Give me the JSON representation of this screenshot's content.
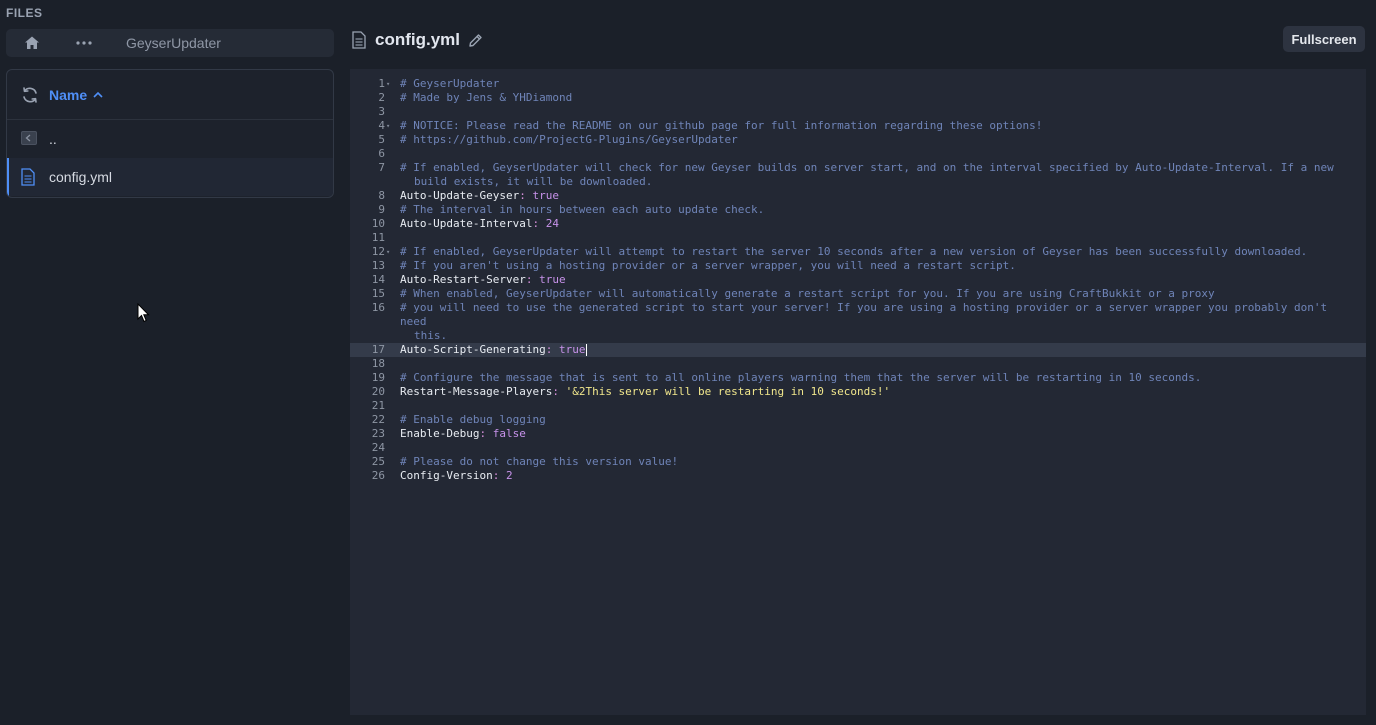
{
  "sidebar": {
    "section_label": "FILES",
    "breadcrumb_current": "GeyserUpdater",
    "sort_label": "Name",
    "files": [
      {
        "name": ".."
      },
      {
        "name": "config.yml"
      }
    ]
  },
  "editor": {
    "filename": "config.yml",
    "fullscreen_label": "Fullscreen",
    "current_line": 17,
    "lines": [
      {
        "num": "1",
        "fold": true,
        "parts": [
          {
            "t": "# GeyserUpdater",
            "c": "comment"
          }
        ]
      },
      {
        "num": "2",
        "parts": [
          {
            "t": "# Made by Jens & YHDiamond",
            "c": "comment"
          }
        ]
      },
      {
        "num": "3",
        "parts": []
      },
      {
        "num": "4",
        "fold": true,
        "parts": [
          {
            "t": "# NOTICE: Please read the README on our github page for full information regarding these options!",
            "c": "comment"
          }
        ]
      },
      {
        "num": "5",
        "parts": [
          {
            "t": "# https://github.com/ProjectG-Plugins/GeyserUpdater",
            "c": "comment"
          }
        ]
      },
      {
        "num": "6",
        "parts": []
      },
      {
        "num": "7",
        "parts": [
          {
            "t": "# If enabled, GeyserUpdater will check for new Geyser builds on server start, and on the interval specified by Auto-Update-Interval. If a new",
            "c": "comment"
          }
        ],
        "cont": "build exists, it will be downloaded."
      },
      {
        "num": "8",
        "parts": [
          {
            "t": "Auto-Update-Geyser",
            "c": "key"
          },
          {
            "t": ": ",
            "c": "punc"
          },
          {
            "t": "true",
            "c": "bool"
          }
        ]
      },
      {
        "num": "9",
        "parts": [
          {
            "t": "# The interval in hours between each auto update check.",
            "c": "comment"
          }
        ]
      },
      {
        "num": "10",
        "parts": [
          {
            "t": "Auto-Update-Interval",
            "c": "key"
          },
          {
            "t": ": ",
            "c": "punc"
          },
          {
            "t": "24",
            "c": "num"
          }
        ]
      },
      {
        "num": "11",
        "parts": []
      },
      {
        "num": "12",
        "fold": true,
        "parts": [
          {
            "t": "# If enabled, GeyserUpdater will attempt to restart the server 10 seconds after a new version of Geyser has been successfully downloaded.",
            "c": "comment"
          }
        ]
      },
      {
        "num": "13",
        "parts": [
          {
            "t": "# If you aren't using a hosting provider or a server wrapper, you will need a restart script.",
            "c": "comment"
          }
        ]
      },
      {
        "num": "14",
        "parts": [
          {
            "t": "Auto-Restart-Server",
            "c": "key"
          },
          {
            "t": ": ",
            "c": "punc"
          },
          {
            "t": "true",
            "c": "bool"
          }
        ]
      },
      {
        "num": "15",
        "parts": [
          {
            "t": "# When enabled, GeyserUpdater will automatically generate a restart script for you. If you are using CraftBukkit or a proxy",
            "c": "comment"
          }
        ]
      },
      {
        "num": "16",
        "parts": [
          {
            "t": "# you will need to use the generated script to start your server! If you are using a hosting provider or a server wrapper you probably don't need",
            "c": "comment"
          }
        ],
        "cont": "this."
      },
      {
        "num": "17",
        "parts": [
          {
            "t": "Auto-Script-Generating",
            "c": "key"
          },
          {
            "t": ": ",
            "c": "punc"
          },
          {
            "t": "true",
            "c": "bool"
          }
        ]
      },
      {
        "num": "18",
        "parts": []
      },
      {
        "num": "19",
        "parts": [
          {
            "t": "# Configure the message that is sent to all online players warning them that the server will be restarting in 10 seconds.",
            "c": "comment"
          }
        ]
      },
      {
        "num": "20",
        "parts": [
          {
            "t": "Restart-Message-Players",
            "c": "key"
          },
          {
            "t": ": ",
            "c": "punc"
          },
          {
            "t": "'&2This server will be restarting in 10 seconds!'",
            "c": "str"
          }
        ]
      },
      {
        "num": "21",
        "parts": []
      },
      {
        "num": "22",
        "parts": [
          {
            "t": "# Enable debug logging",
            "c": "comment"
          }
        ]
      },
      {
        "num": "23",
        "parts": [
          {
            "t": "Enable-Debug",
            "c": "key"
          },
          {
            "t": ": ",
            "c": "punc"
          },
          {
            "t": "false",
            "c": "bool"
          }
        ]
      },
      {
        "num": "24",
        "parts": []
      },
      {
        "num": "25",
        "parts": [
          {
            "t": "# Please do not change this version value!",
            "c": "comment"
          }
        ]
      },
      {
        "num": "26",
        "parts": [
          {
            "t": "Config-Version",
            "c": "key"
          },
          {
            "t": ": ",
            "c": "punc"
          },
          {
            "t": "2",
            "c": "num"
          }
        ]
      }
    ]
  },
  "colors": {
    "accent": "#4f8ff7",
    "comment": "#6f84b8",
    "string": "#f0e68c",
    "value": "#c792ea"
  },
  "icons": {
    "home": "home-icon",
    "more": "more-icon",
    "refresh": "refresh-icon",
    "file": "file-icon",
    "folder_up": "folder-up-icon",
    "pencil": "pencil-icon"
  }
}
